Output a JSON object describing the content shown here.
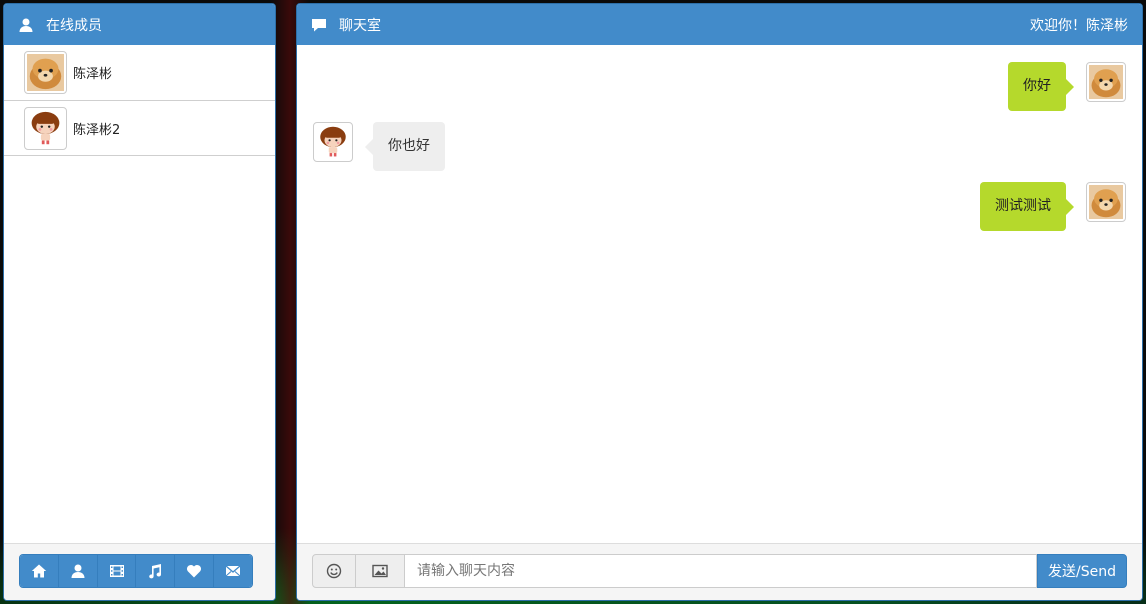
{
  "colors": {
    "primary": "#428bca",
    "my_bubble": "#b5d92c",
    "other_bubble": "#eeeeee"
  },
  "members_panel": {
    "title": "在线成员",
    "title_icon": "user-icon",
    "members": [
      {
        "name": "陈泽彬",
        "avatar": "dog-avatar"
      },
      {
        "name": "陈泽彬2",
        "avatar": "girl-avatar"
      }
    ],
    "toolbar_icons": [
      "home-icon",
      "user-icon",
      "film-icon",
      "music-icon",
      "heart-icon",
      "envelope-icon"
    ]
  },
  "chat_panel": {
    "title": "聊天室",
    "title_icon": "comment-icon",
    "welcome": "欢迎你！陈泽彬",
    "messages": [
      {
        "text": "你好",
        "side": "me",
        "avatar": "dog-avatar"
      },
      {
        "text": "你也好",
        "side": "other",
        "avatar": "girl-avatar"
      },
      {
        "text": "测试测试",
        "side": "me",
        "avatar": "dog-avatar"
      }
    ],
    "input_placeholder": "请输入聊天内容",
    "emoji_icon": "smile-icon",
    "image_icon": "picture-icon",
    "send_label": "发送/Send"
  }
}
